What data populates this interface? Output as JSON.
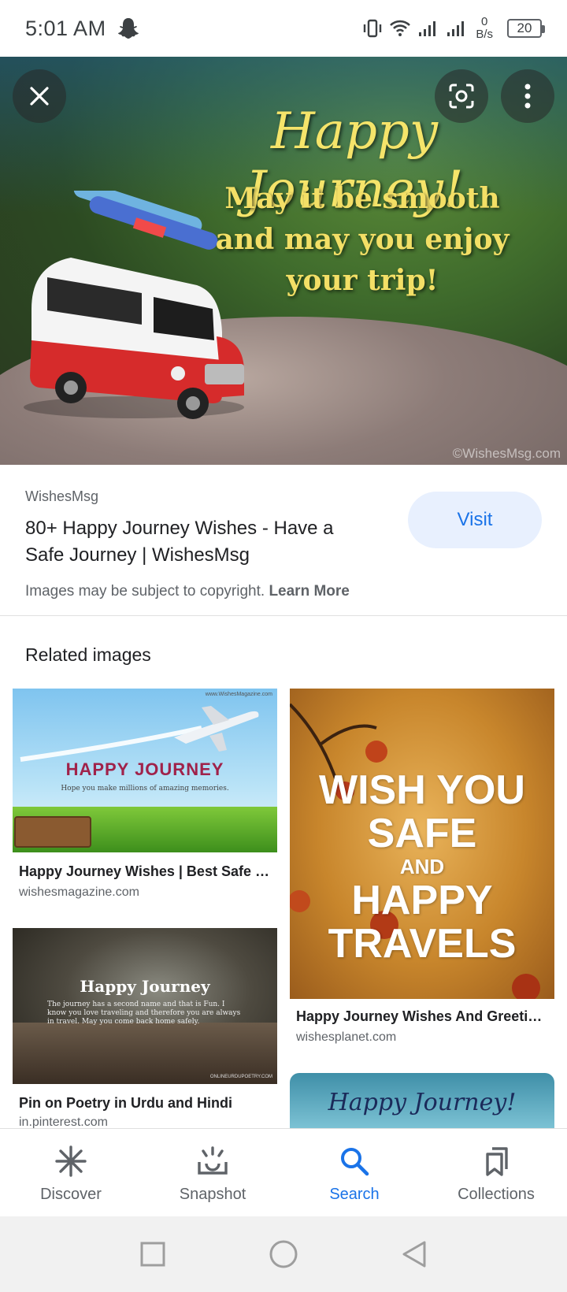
{
  "status_bar": {
    "time": "5:01 AM",
    "net_speed_value": "0",
    "net_speed_unit": "B/s",
    "battery": "20"
  },
  "hero": {
    "title": "Happy Journey!",
    "subtitle_lines": [
      "May it be smooth",
      "and may you enjoy",
      "your trip!"
    ],
    "watermark": "©WishesMsg.com"
  },
  "result": {
    "site": "WishesMsg",
    "title": "80+ Happy Journey Wishes - Have a Safe Journey | WishesMsg",
    "visit_label": "Visit",
    "copyright_text": "Images may be subject to copyright.",
    "learn_more": "Learn More"
  },
  "related": {
    "heading": "Related images",
    "items": [
      {
        "thumb_heading": "HAPPY JOURNEY",
        "thumb_sub": "Hope you make millions of amazing memories.",
        "thumb_watermark": "www.WishesMagazine.com",
        "title": "Happy Journey Wishes | Best Safe Journey Wishes",
        "domain": "wishesmagazine.com"
      },
      {
        "thumb_lines": [
          "WISH YOU",
          "SAFE",
          "AND",
          "HAPPY",
          "TRAVELS"
        ],
        "title": "Happy Journey Wishes And Greetings",
        "domain": "wishesplanet.com"
      },
      {
        "thumb_heading": "Happy Journey",
        "thumb_body": "The journey has a second name and that is Fun. I know you love traveling and therefore you are always in travel. May you come back home safely.",
        "thumb_watermark": "ONLINEURDUPOETRY.COM",
        "title": "Pin on Poetry in Urdu and Hindi",
        "domain": "in.pinterest.com"
      },
      {
        "thumb_heading": "Happy Journey!"
      }
    ]
  },
  "bottom_nav": [
    {
      "label": "Discover",
      "icon": "asterisk-icon"
    },
    {
      "label": "Snapshot",
      "icon": "snapshot-icon"
    },
    {
      "label": "Search",
      "icon": "search-icon",
      "active": true
    },
    {
      "label": "Collections",
      "icon": "bookmarks-icon"
    }
  ],
  "colors": {
    "accent": "#1a73e8",
    "visit_bg": "#e8f0fe"
  }
}
